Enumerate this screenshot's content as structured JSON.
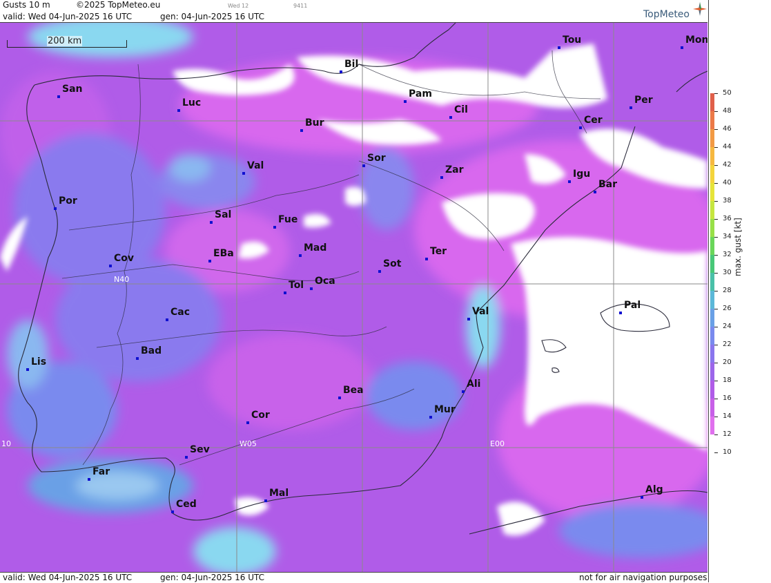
{
  "header": {
    "product": "Gusts 10 m",
    "copyright": "©2025 TopMeteo.eu",
    "day_tag": "Wed 12",
    "code": "9411",
    "valid": "valid:  Wed  04-Jun-2025  16 UTC",
    "gen": "gen: 04-Jun-2025 16 UTC",
    "brand": "TopMeteo"
  },
  "footer": {
    "valid": "valid:  Wed  04-Jun-2025  16 UTC",
    "gen": "gen: 04-Jun-2025 16 UTC",
    "disclaimer": "not for air navigation purposes"
  },
  "scale_bar": "200 km",
  "grid_labels": {
    "lat_n40_left": "N40",
    "lat_n40_right": "N40",
    "lon_w10": "10",
    "lon_w05": "W05",
    "lon_e00": "E00"
  },
  "legend": {
    "title": "max. gust [kt]",
    "ticks": [
      50,
      48,
      46,
      44,
      42,
      40,
      38,
      36,
      34,
      32,
      30,
      28,
      26,
      24,
      22,
      20,
      18,
      16,
      14,
      12,
      10
    ],
    "colors": [
      "#e0604a",
      "#ec7a48",
      "#f29a44",
      "#f6b840",
      "#f4d43c",
      "#e6e43a",
      "#c6e640",
      "#98e048",
      "#6ad65a",
      "#48c878",
      "#4ac0a8",
      "#5cb8d8",
      "#6aa0e6",
      "#7a8aee",
      "#8a76ee",
      "#9c66ea",
      "#b05ce8",
      "#c860e8",
      "#e070ee"
    ]
  },
  "cities": [
    {
      "name": "Tou"
    },
    {
      "name": "Mon"
    },
    {
      "name": "Bil"
    },
    {
      "name": "San"
    },
    {
      "name": "Pam"
    },
    {
      "name": "Luc"
    },
    {
      "name": "Cil"
    },
    {
      "name": "Per"
    },
    {
      "name": "Bur"
    },
    {
      "name": "Cer"
    },
    {
      "name": "Sor"
    },
    {
      "name": "Val"
    },
    {
      "name": "Zar"
    },
    {
      "name": "Igu"
    },
    {
      "name": "Bar"
    },
    {
      "name": "Por"
    },
    {
      "name": "Sal"
    },
    {
      "name": "Fue"
    },
    {
      "name": "Mad"
    },
    {
      "name": "Ter"
    },
    {
      "name": "Cov"
    },
    {
      "name": "EBa"
    },
    {
      "name": "Sot"
    },
    {
      "name": "Tol"
    },
    {
      "name": "Oca"
    },
    {
      "name": "Cac"
    },
    {
      "name": "Val"
    },
    {
      "name": "Pal"
    },
    {
      "name": "Bad"
    },
    {
      "name": "Lis"
    },
    {
      "name": "Bea"
    },
    {
      "name": "Ali"
    },
    {
      "name": "Mur"
    },
    {
      "name": "Cor"
    },
    {
      "name": "Sev"
    },
    {
      "name": "Far"
    },
    {
      "name": "Mal"
    },
    {
      "name": "Alg"
    },
    {
      "name": "Ced"
    }
  ],
  "colors": {
    "gust_12_14": "#e070ee",
    "gust_14_16": "#c860e8",
    "gust_16_18": "#b05ce8",
    "gust_18_20": "#9c66ea",
    "gust_20_22": "#7a8aee",
    "gust_22_26": "#6aa0e6",
    "gust_26_28": "#8ad8f0",
    "gust_below_12": "#ffffff",
    "station_dot": "#1010d0"
  }
}
